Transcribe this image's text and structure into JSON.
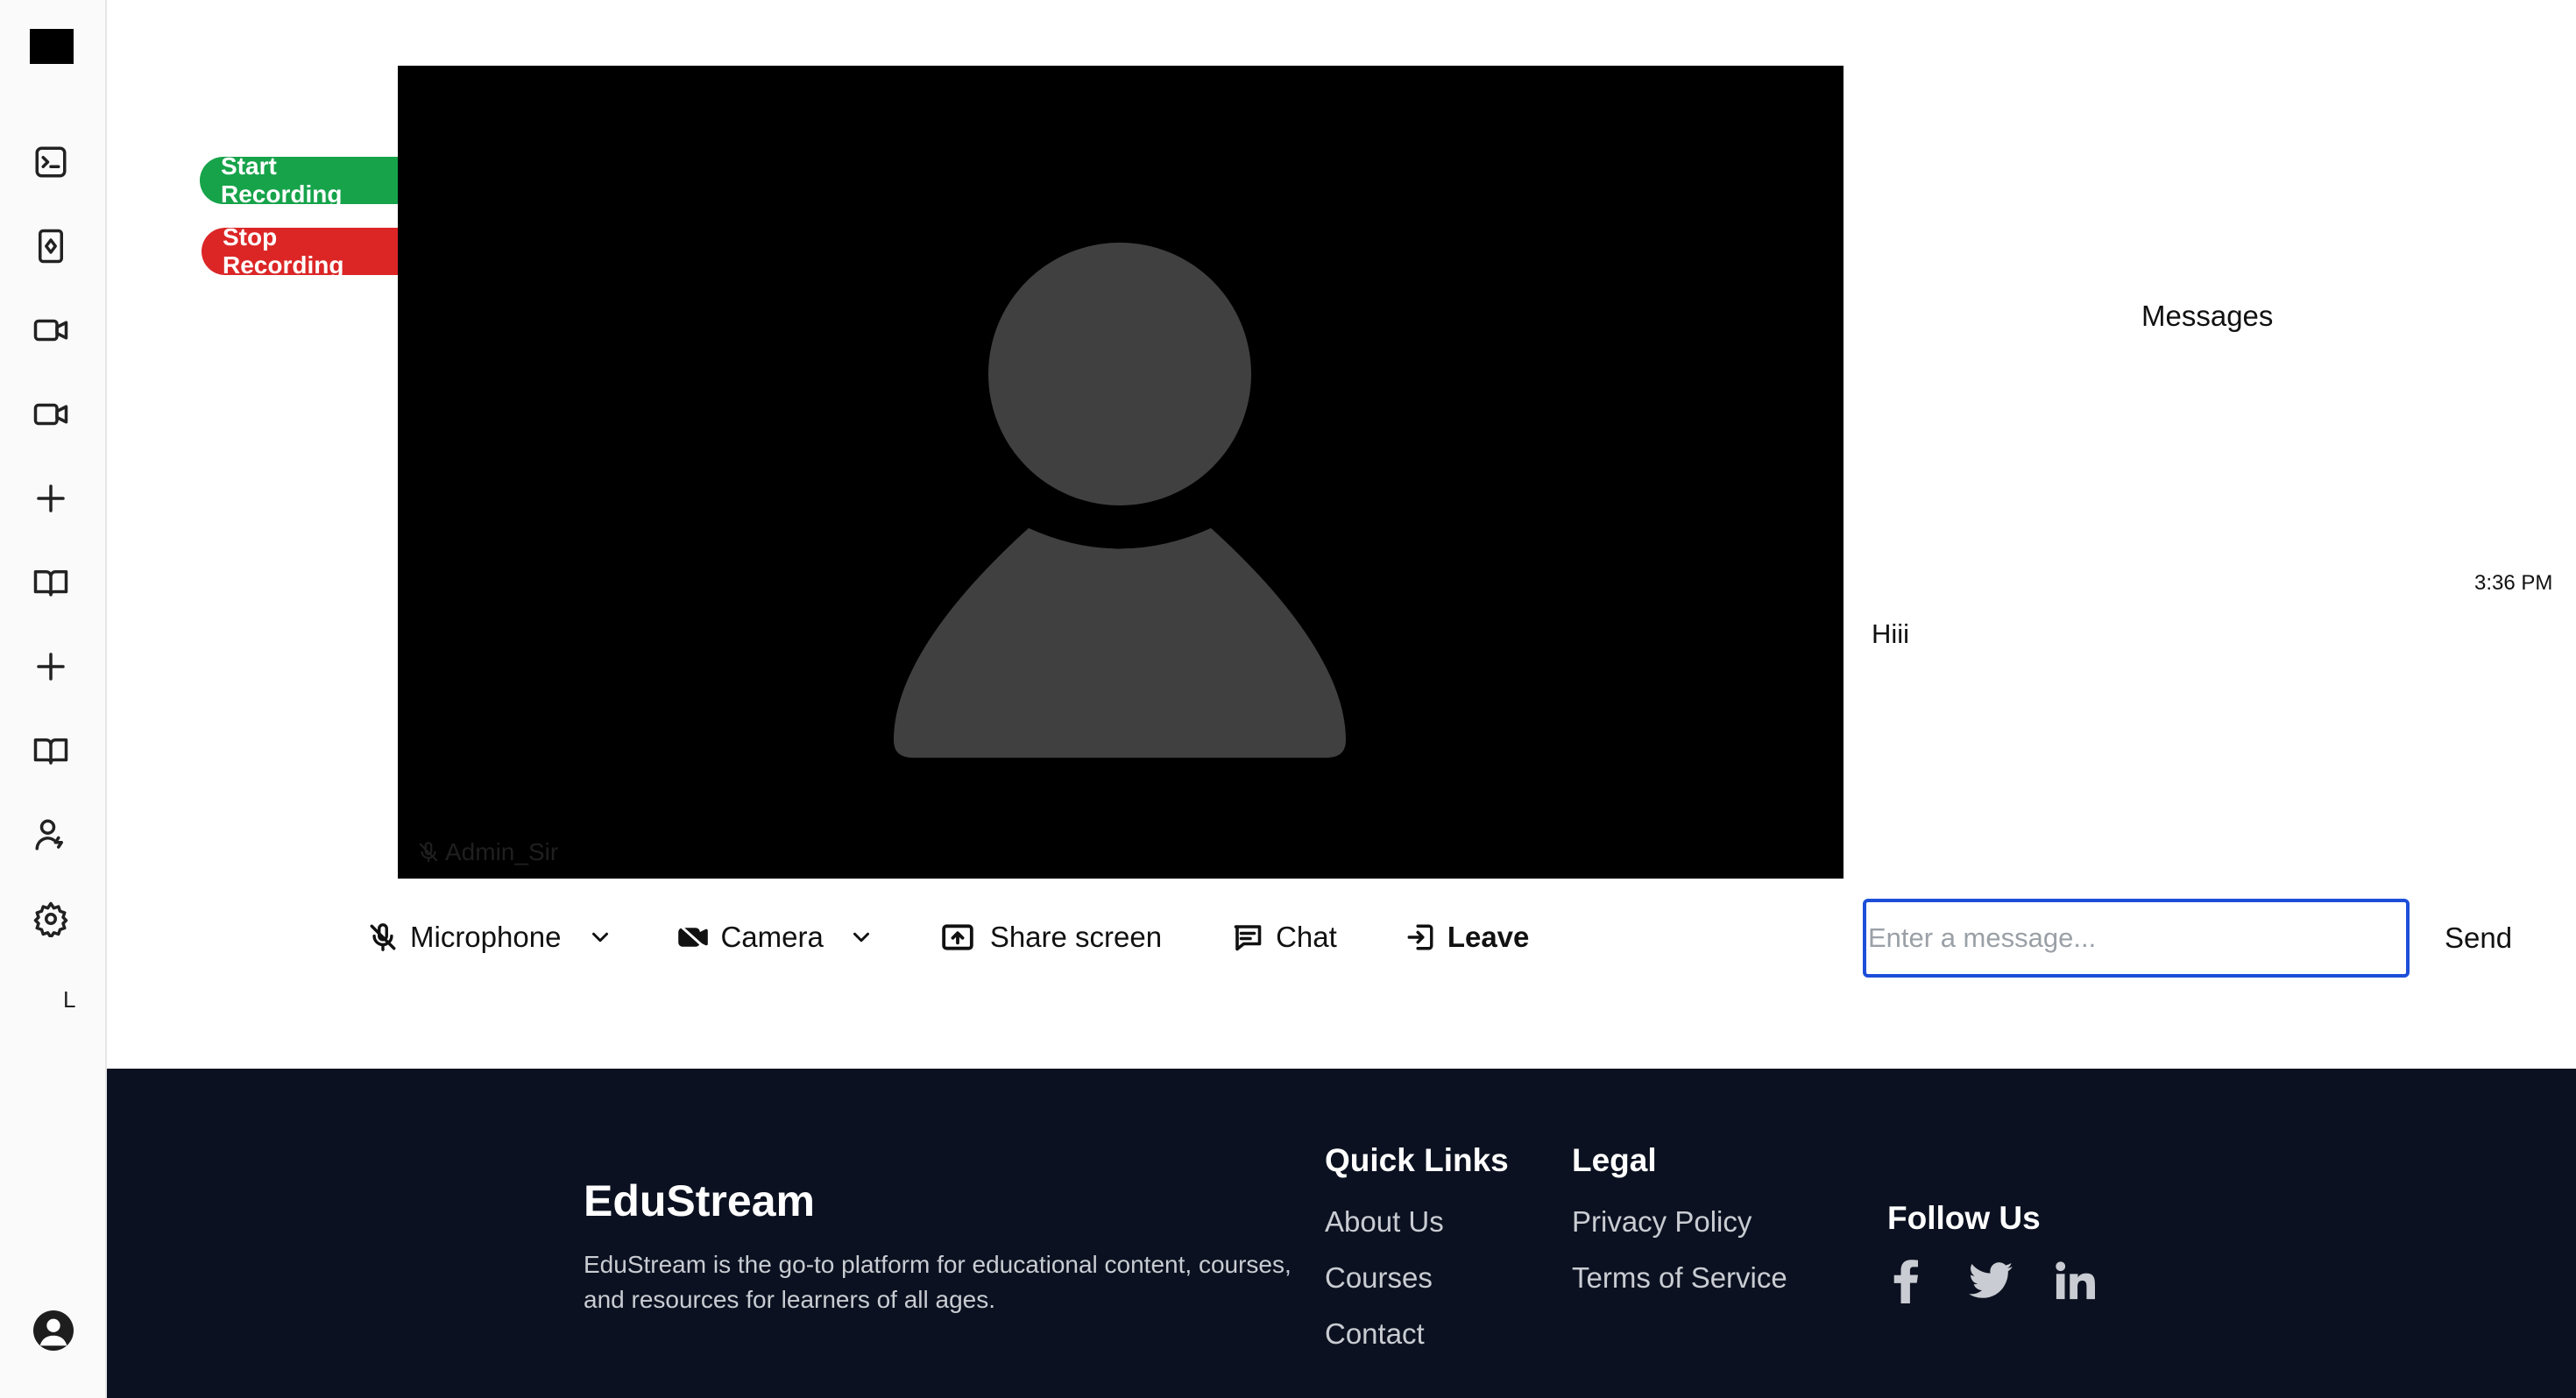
{
  "recording": {
    "start_label": "Start Recording",
    "stop_label": "Stop Recording"
  },
  "video": {
    "participant_name": "Admin_Sir"
  },
  "controls": {
    "microphone": "Microphone",
    "camera": "Camera",
    "share_screen": "Share screen",
    "chat": "Chat",
    "leave": "Leave"
  },
  "chat_panel": {
    "title": "Messages",
    "messages": [
      {
        "time": "3:36 PM",
        "text": "Hiii"
      }
    ],
    "input_placeholder": "Enter a message...",
    "send_label": "Send"
  },
  "sidebar": {
    "letter": "L"
  },
  "footer": {
    "brand": "EduStream",
    "description": "EduStream is the go-to platform for educational content, courses, and resources for learners of all ages.",
    "quick_links": {
      "title": "Quick Links",
      "items": [
        "About Us",
        "Courses",
        "Contact"
      ]
    },
    "legal": {
      "title": "Legal",
      "items": [
        "Privacy Policy",
        "Terms of Service"
      ]
    },
    "follow": {
      "title": "Follow Us",
      "icons": [
        "facebook-icon",
        "twitter-icon",
        "linkedin-icon"
      ]
    }
  },
  "colors": {
    "record_start": "#16a34a",
    "record_stop": "#dc2626",
    "input_focus": "#1d4ed8",
    "footer_bg": "#0b1120"
  }
}
